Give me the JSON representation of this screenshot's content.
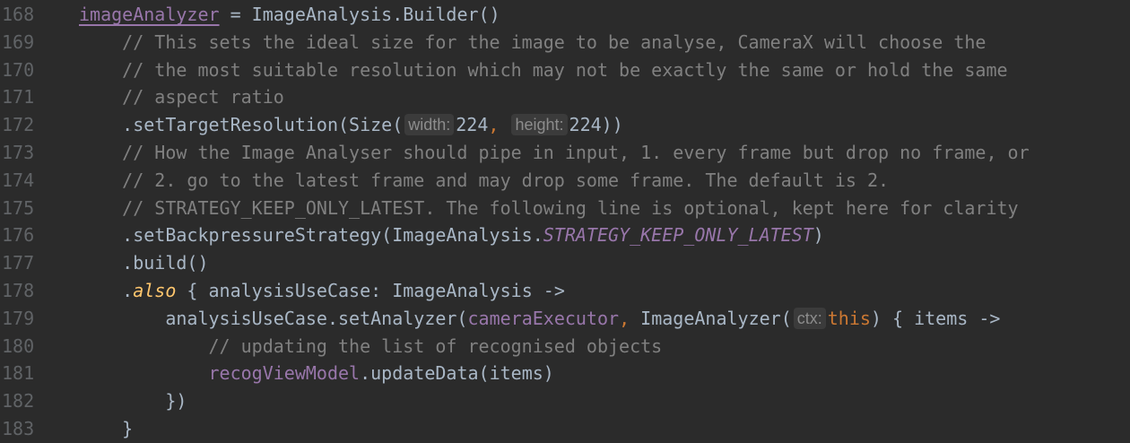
{
  "editor": {
    "lines": [
      {
        "num": "168",
        "segments": [
          {
            "cls": "prop-u",
            "text": "imageAnalyzer"
          },
          {
            "cls": "",
            "text": " = ImageAnalysis.Builder()"
          }
        ]
      },
      {
        "num": "169",
        "segments": [
          {
            "cls": "cmt",
            "text": "    // This sets the ideal size for the image to be analyse, CameraX will choose the"
          }
        ]
      },
      {
        "num": "170",
        "segments": [
          {
            "cls": "cmt",
            "text": "    // the most suitable resolution which may not be exactly the same or hold the same"
          }
        ]
      },
      {
        "num": "171",
        "segments": [
          {
            "cls": "cmt",
            "text": "    // aspect ratio"
          }
        ]
      },
      {
        "num": "172",
        "segments": [
          {
            "cls": "",
            "text": "    .setTargetResolution(Size("
          },
          {
            "cls": "hint",
            "text": "width:"
          },
          {
            "cls": "",
            "text": "224"
          },
          {
            "cls": "kw",
            "text": ", "
          },
          {
            "cls": "hint",
            "text": "height:"
          },
          {
            "cls": "",
            "text": "224))"
          }
        ]
      },
      {
        "num": "173",
        "segments": [
          {
            "cls": "cmt",
            "text": "    // How the Image Analyser should pipe in input, 1. every frame but drop no frame, or"
          }
        ]
      },
      {
        "num": "174",
        "segments": [
          {
            "cls": "cmt",
            "text": "    // 2. go to the latest frame and may drop some frame. The default is 2."
          }
        ]
      },
      {
        "num": "175",
        "segments": [
          {
            "cls": "cmt",
            "text": "    // STRATEGY_KEEP_ONLY_LATEST. The following line is optional, kept here for clarity"
          }
        ]
      },
      {
        "num": "176",
        "segments": [
          {
            "cls": "",
            "text": "    .setBackpressureStrategy(ImageAnalysis."
          },
          {
            "cls": "const",
            "text": "STRATEGY_KEEP_ONLY_LATEST"
          },
          {
            "cls": "",
            "text": ")"
          }
        ]
      },
      {
        "num": "177",
        "segments": [
          {
            "cls": "",
            "text": "    .build()"
          }
        ]
      },
      {
        "num": "178",
        "segments": [
          {
            "cls": "",
            "text": "    ."
          },
          {
            "cls": "also",
            "text": "also"
          },
          {
            "cls": "",
            "text": " { analysisUseCase: ImageAnalysis ->"
          }
        ]
      },
      {
        "num": "179",
        "segments": [
          {
            "cls": "",
            "text": "        analysisUseCase.setAnalyzer("
          },
          {
            "cls": "prop",
            "text": "cameraExecutor"
          },
          {
            "cls": "kw",
            "text": ", "
          },
          {
            "cls": "",
            "text": "ImageAnalyzer("
          },
          {
            "cls": "hint",
            "text": "ctx:"
          },
          {
            "cls": "kw",
            "text": "this"
          },
          {
            "cls": "",
            "text": ") { items ->"
          }
        ]
      },
      {
        "num": "180",
        "segments": [
          {
            "cls": "cmt",
            "text": "            // updating the list of recognised objects"
          }
        ]
      },
      {
        "num": "181",
        "segments": [
          {
            "cls": "",
            "text": "            "
          },
          {
            "cls": "prop",
            "text": "recogViewModel"
          },
          {
            "cls": "",
            "text": ".updateData(items)"
          }
        ]
      },
      {
        "num": "182",
        "segments": [
          {
            "cls": "",
            "text": "        })"
          }
        ]
      },
      {
        "num": "183",
        "segments": [
          {
            "cls": "",
            "text": "    }"
          }
        ]
      }
    ]
  }
}
